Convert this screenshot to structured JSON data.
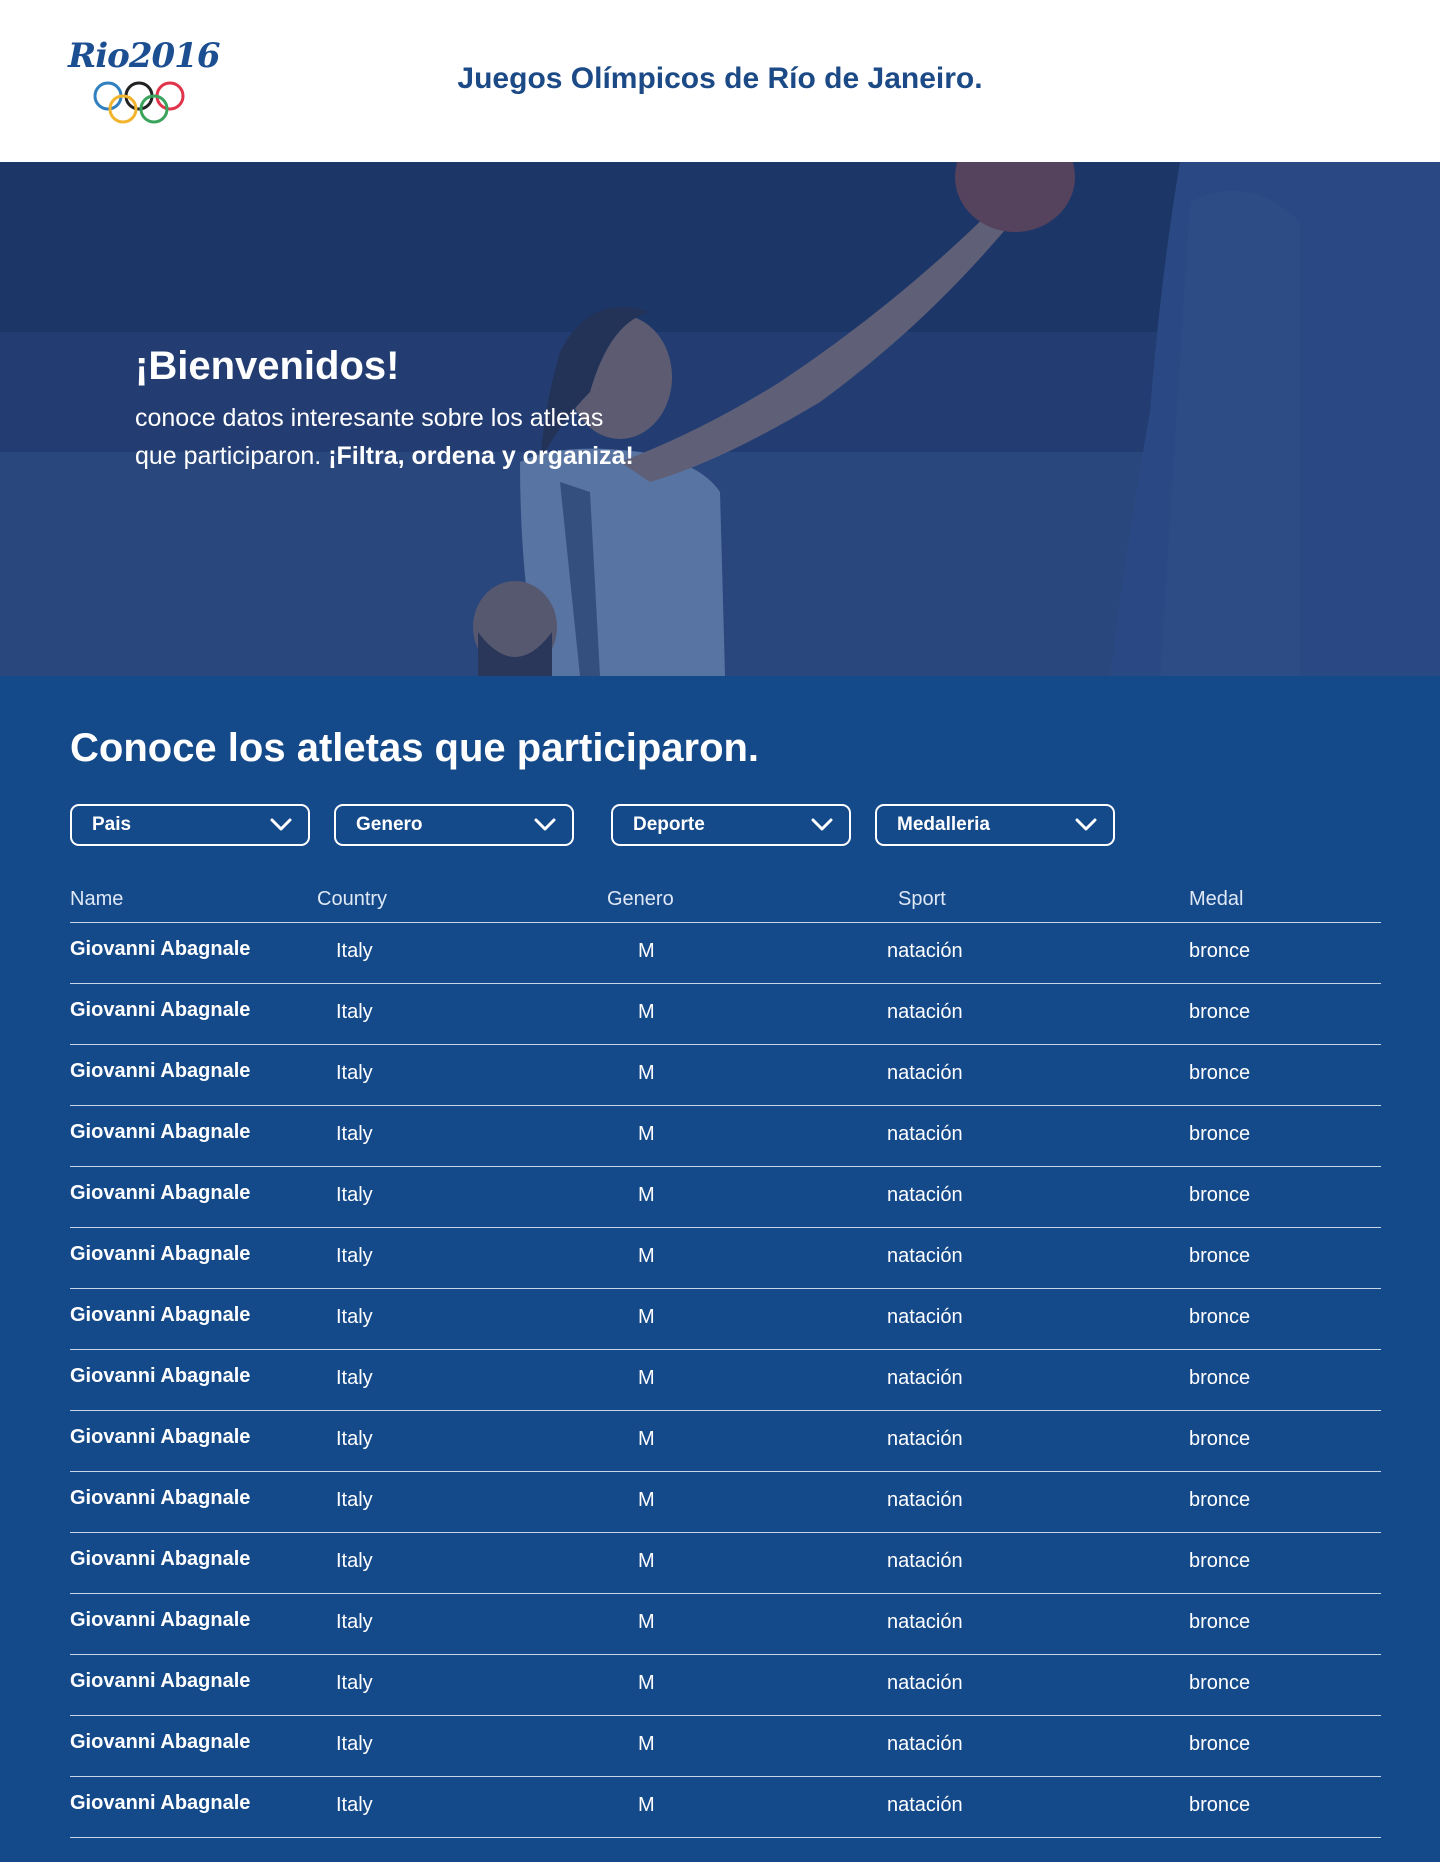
{
  "header": {
    "logo_text": "Rio2016",
    "title": "Juegos Olímpicos de Río de Janeiro."
  },
  "hero": {
    "heading": "¡Bienvenidos!",
    "subtitle_line1": "conoce datos interesante sobre los atletas",
    "subtitle_line2_plain": "que participaron.",
    "subtitle_line2_bold": "¡Filtra, ordena y organiza!"
  },
  "section": {
    "title": "Conoce los atletas que participaron."
  },
  "filters": [
    {
      "label": "Pais",
      "icon": "chevron-down-icon"
    },
    {
      "label": "Genero",
      "icon": "chevron-down-icon"
    },
    {
      "label": "Deporte",
      "icon": "chevron-down-icon"
    },
    {
      "label": "Medalleria",
      "icon": "chevron-down-icon"
    }
  ],
  "table": {
    "headers": [
      "Name",
      "Country",
      "Genero",
      "Sport",
      "Medal"
    ],
    "rows": [
      [
        "Giovanni Abagnale",
        "Italy",
        "M",
        "natación",
        "bronce"
      ],
      [
        "Giovanni Abagnale",
        "Italy",
        "M",
        "natación",
        "bronce"
      ],
      [
        "Giovanni Abagnale",
        "Italy",
        "M",
        "natación",
        "bronce"
      ],
      [
        "Giovanni Abagnale",
        "Italy",
        "M",
        "natación",
        "bronce"
      ],
      [
        "Giovanni Abagnale",
        "Italy",
        "M",
        "natación",
        "bronce"
      ],
      [
        "Giovanni Abagnale",
        "Italy",
        "M",
        "natación",
        "bronce"
      ],
      [
        "Giovanni Abagnale",
        "Italy",
        "M",
        "natación",
        "bronce"
      ],
      [
        "Giovanni Abagnale",
        "Italy",
        "M",
        "natación",
        "bronce"
      ],
      [
        "Giovanni Abagnale",
        "Italy",
        "M",
        "natación",
        "bronce"
      ],
      [
        "Giovanni Abagnale",
        "Italy",
        "M",
        "natación",
        "bronce"
      ],
      [
        "Giovanni Abagnale",
        "Italy",
        "M",
        "natación",
        "bronce"
      ],
      [
        "Giovanni Abagnale",
        "Italy",
        "M",
        "natación",
        "bronce"
      ],
      [
        "Giovanni Abagnale",
        "Italy",
        "M",
        "natación",
        "bronce"
      ],
      [
        "Giovanni Abagnale",
        "Italy",
        "M",
        "natación",
        "bronce"
      ],
      [
        "Giovanni Abagnale",
        "Italy",
        "M",
        "natación",
        "bronce"
      ]
    ]
  },
  "colors": {
    "primary_blue": "#14498a",
    "header_title": "#1c4a86",
    "ring_blue": "#2f7fc1",
    "ring_yellow": "#f2b32d",
    "ring_black": "#222222",
    "ring_green": "#3aa35c",
    "ring_red": "#e0344a"
  }
}
